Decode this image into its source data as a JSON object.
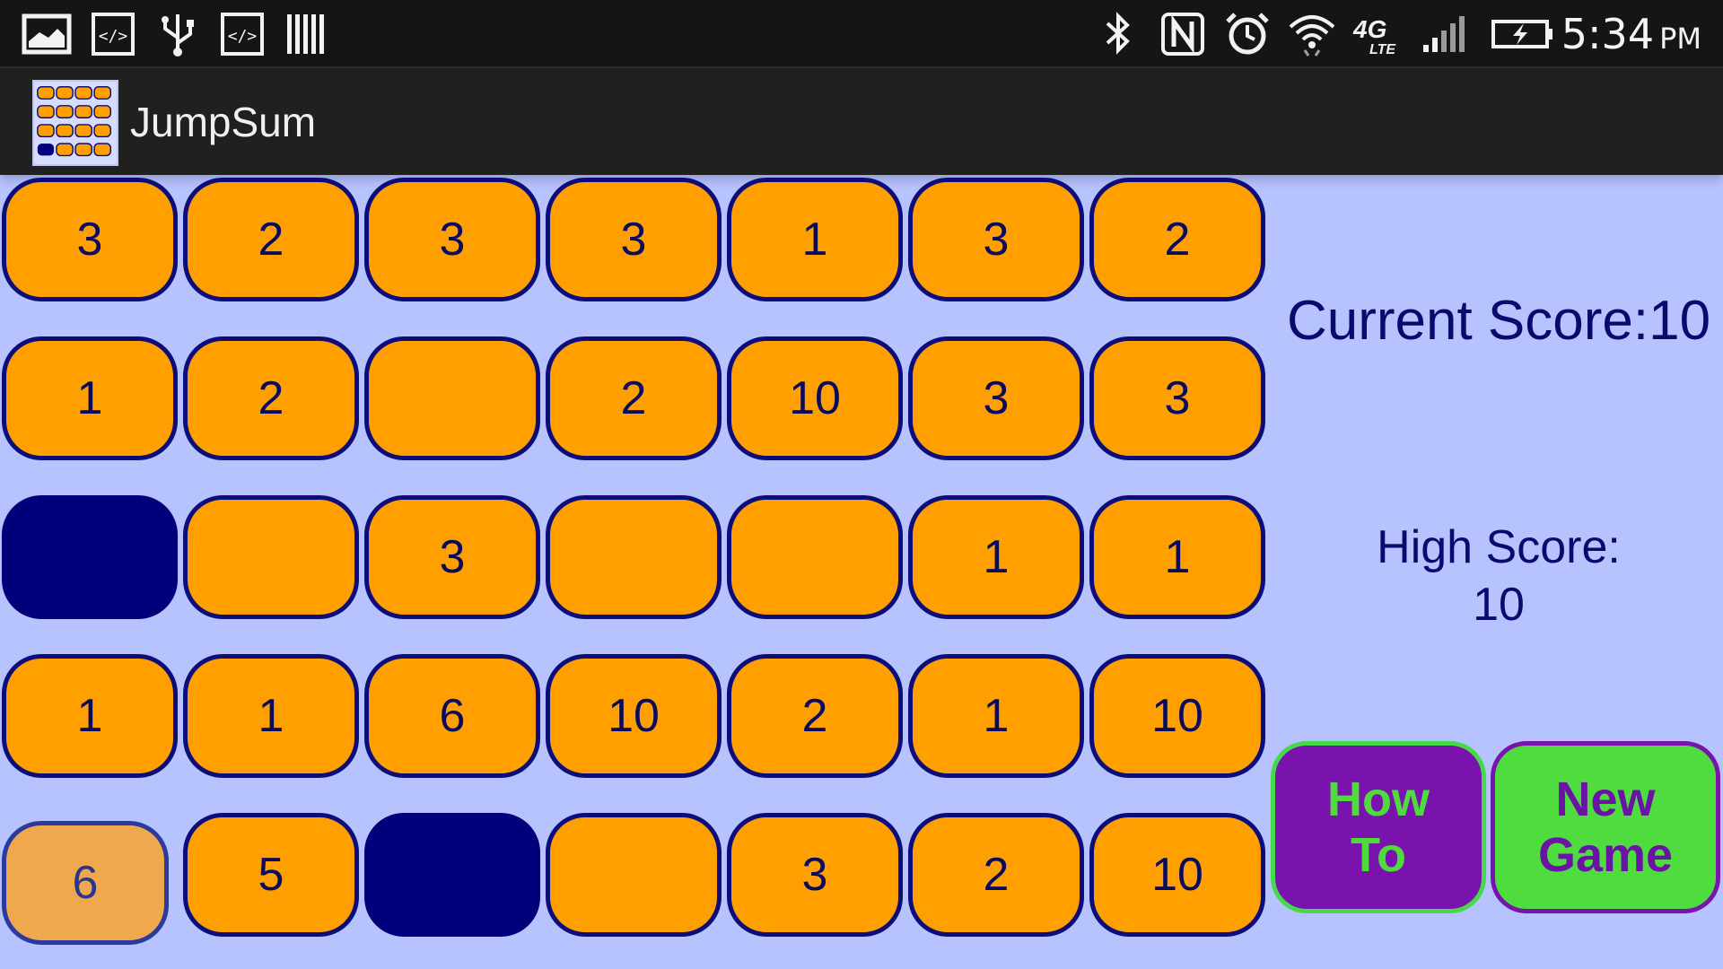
{
  "status_bar": {
    "time": "5:34",
    "ampm": "PM",
    "left_icons": [
      "gallery-icon",
      "developer-code-icon",
      "usb-icon",
      "developer-code-icon",
      "barcode-icon"
    ],
    "right_icons": [
      "bluetooth-icon",
      "nfc-icon",
      "alarm-icon",
      "wifi-icon",
      "4g-lte-icon",
      "signal-icon",
      "battery-charging-icon"
    ]
  },
  "action_bar": {
    "title": "JumpSum",
    "icon": "app-board-icon"
  },
  "board": {
    "rows": [
      [
        "3",
        "2",
        "3",
        "3",
        "1",
        "3",
        "2"
      ],
      [
        "1",
        "2",
        "",
        "2",
        "10",
        "3",
        "3"
      ],
      [
        "",
        "",
        "3",
        "",
        "",
        "1",
        "1"
      ],
      [
        "1",
        "1",
        "6",
        "10",
        "2",
        "1",
        "10"
      ],
      [
        "6",
        "5",
        "",
        "",
        "3",
        "2",
        "10"
      ]
    ],
    "empty_holes": [
      [
        2,
        0
      ],
      [
        4,
        2
      ]
    ],
    "selected": [
      4,
      0
    ],
    "colors": {
      "tile": "#ffa000",
      "tile_border": "#0c0c7a",
      "hole": "#01007a",
      "selected": "#efa84c",
      "background": "#b6c3ff"
    }
  },
  "scores": {
    "current_label": "Current Score:",
    "current_value": "10",
    "high_label": "High Score:",
    "high_value": "10"
  },
  "buttons": {
    "how_to_line1": "How",
    "how_to_line2": "To",
    "new_game_line1": "New",
    "new_game_line2": "Game"
  }
}
